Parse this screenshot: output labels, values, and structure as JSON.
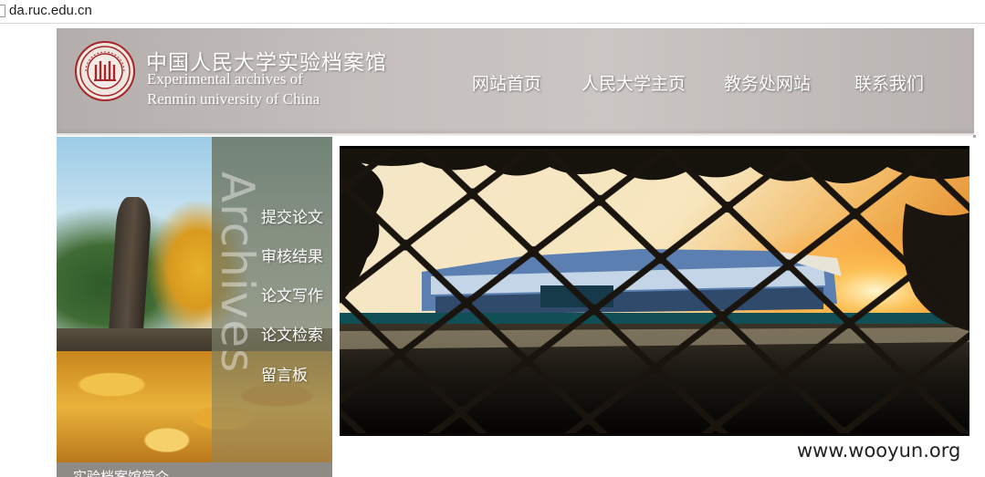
{
  "browser": {
    "url": "da.ruc.edu.cn"
  },
  "header": {
    "title": "中国人民大学实验档案馆",
    "subtitle_line1": "Experimental archives of",
    "subtitle_line2": "Renmin university of China",
    "logo_icon": "university-seal-icon",
    "nav": [
      "网站首页",
      "人民大学主页",
      "教务处网站",
      "联系我们"
    ]
  },
  "sidebar": {
    "watermark_word": "Archives",
    "menu": [
      "提交论文",
      "审核结果",
      "论文写作",
      "论文检索",
      "留言板"
    ],
    "intro_label": "实验档案馆简介"
  },
  "banner": {
    "description_icon": "stadium-through-fence-photo"
  },
  "watermark": "www.wooyun.org",
  "colors": {
    "header_bg": "#c5c0bd",
    "seal_red": "#a8262a",
    "intro_bar": "#8e8a86"
  }
}
